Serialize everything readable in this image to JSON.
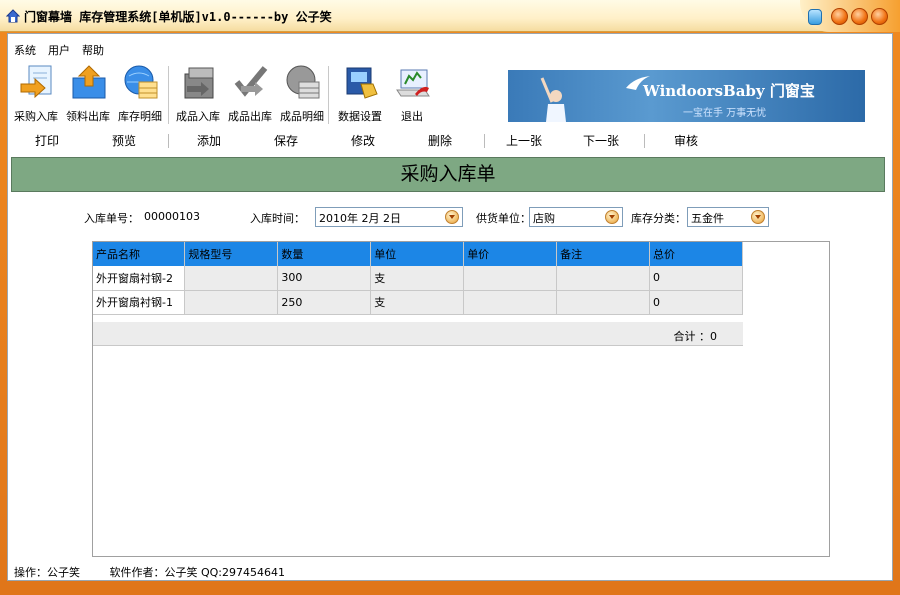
{
  "window": {
    "title": "门窗幕墙 库存管理系统[单机版]v1.0------by 公子笑"
  },
  "menu": [
    "系统",
    "用户",
    "帮助"
  ],
  "toolbar": [
    {
      "label": "采购入库",
      "icon": "purchase-inbound-icon"
    },
    {
      "label": "领料出库",
      "icon": "material-outbound-icon"
    },
    {
      "label": "库存明细",
      "icon": "stock-detail-icon"
    },
    {
      "label": "成品入库",
      "icon": "product-inbound-icon"
    },
    {
      "label": "成品出库",
      "icon": "product-outbound-icon"
    },
    {
      "label": "成品明细",
      "icon": "product-detail-icon"
    },
    {
      "label": "数据设置",
      "icon": "data-settings-icon"
    },
    {
      "label": "退出",
      "icon": "exit-icon"
    }
  ],
  "banner": {
    "brand": "WindoorsBaby 门窗宝",
    "slogan": "一宝在手 万事无忧"
  },
  "actions": [
    "打印",
    "预览",
    "添加",
    "保存",
    "修改",
    "删除",
    "上一张",
    "下一张",
    "审核"
  ],
  "heading": "采购入库单",
  "form": {
    "order_no_label": "入库单号：",
    "order_no": "00000103",
    "date_label": "入库时间：",
    "date": "2010年 2月 2日",
    "supplier_label": "供货单位：",
    "supplier": "店购",
    "category_label": "库存分类：",
    "category": "五金件"
  },
  "table": {
    "columns": [
      "产品名称",
      "规格型号",
      "数量",
      "单位",
      "单价",
      "备注",
      "总价"
    ],
    "rows": [
      [
        "外开窗扇衬钢-2",
        "",
        "300",
        "支",
        "",
        "",
        "0"
      ],
      [
        "外开窗扇衬钢-1",
        "",
        "250",
        "支",
        "",
        "",
        "0"
      ]
    ],
    "total": "合计 ：0"
  },
  "status": {
    "operator": "操作：公子笑",
    "author": "软件作者：公子笑 QQ:297454641"
  },
  "colors": {
    "header_blue": "#1c86e6",
    "heading_green": "#7ea883",
    "frame_orange": "#f08a20"
  }
}
